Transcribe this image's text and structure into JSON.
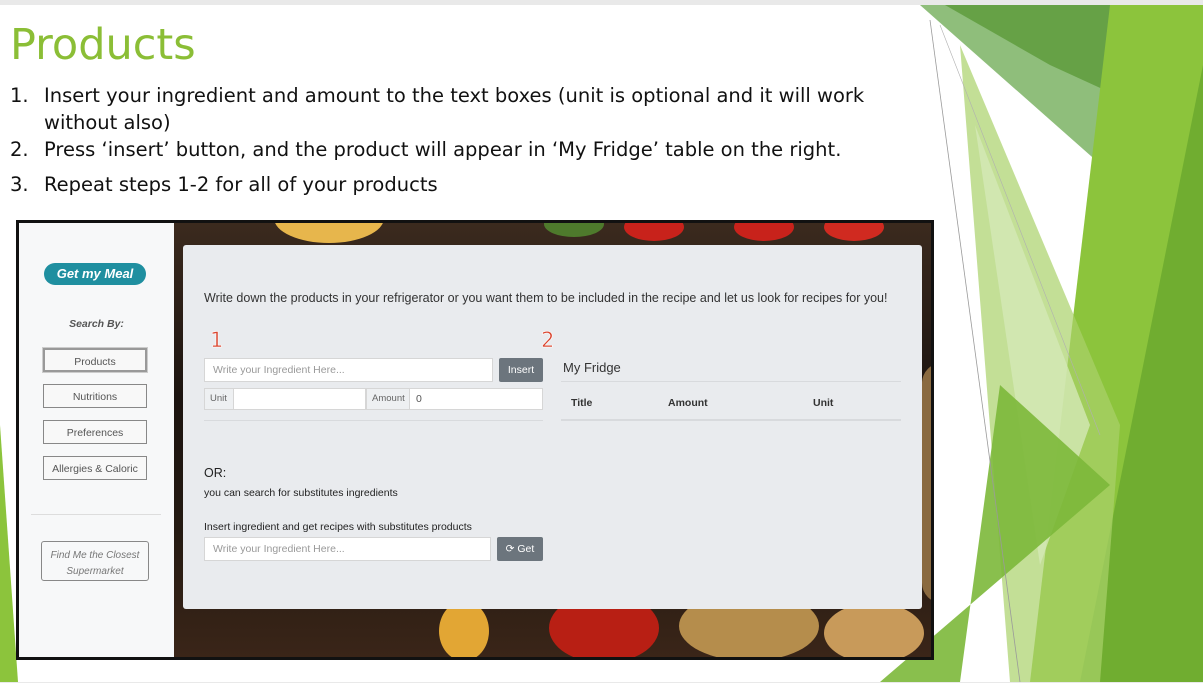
{
  "slide": {
    "title": "Products",
    "steps": [
      {
        "num": "1.",
        "text": "Insert your ingredient and amount  to the text boxes (unit is optional and it will work without also)"
      },
      {
        "num": "2.",
        "text": "Press ‘insert’ button, and the product will appear in ‘My Fridge’ table on the right."
      },
      {
        "num": "3.",
        "text": "Repeat steps 1-2 for all of your products"
      }
    ],
    "accent_color": "#8bbe36"
  },
  "app": {
    "logo": "Get my Meal",
    "search_by": "Search By:",
    "nav": [
      "Products",
      "Nutritions",
      "Preferences",
      "Allergies & Caloric"
    ],
    "closest_button": "Find Me the Closest Supermarket",
    "intro": "Write down the products in your refrigerator or you want them to be included in the recipe and let us look for recipes for you!",
    "marker1": "1",
    "marker2": "2",
    "ingredient_placeholder": "Write your Ingredient Here...",
    "insert_button": "Insert",
    "unit_label": "Unit",
    "amount_label": "Amount",
    "amount_value": "0",
    "fridge": {
      "title": "My Fridge",
      "columns": [
        "Title",
        "Amount",
        "Unit"
      ]
    },
    "or_label": "OR:",
    "substitutes_text": "you can search for substitutes ingredients",
    "substitutes_prompt": "Insert ingredient and get recipes with substitutes products",
    "substitutes_placeholder": "Write your Ingredient Here...",
    "get_button": "Get",
    "brand_color": "#1f8fa0"
  }
}
